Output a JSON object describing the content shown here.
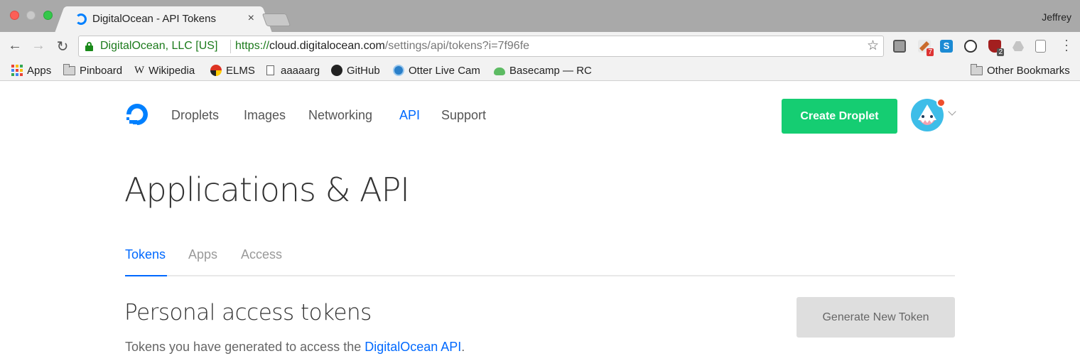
{
  "browser": {
    "tab": {
      "title": "DigitalOcean - API Tokens",
      "close": "×"
    },
    "profile": "Jeffrey",
    "address": {
      "ev_label": "DigitalOcean, LLC [US]",
      "scheme": "https://",
      "host": "cloud.digitalocean.com",
      "path": "/settings/api/tokens?i=7f96fe"
    },
    "extensions": [
      {
        "icon": "extension-plug-icon",
        "badge": ""
      },
      {
        "icon": "extension-ticket-icon",
        "badge": "7"
      },
      {
        "icon": "extension-s-icon",
        "badge": ""
      },
      {
        "icon": "extension-lock-icon",
        "badge": ""
      },
      {
        "icon": "extension-shield-icon",
        "badge": "2"
      },
      {
        "icon": "extension-drive-icon",
        "badge": ""
      },
      {
        "icon": "extension-doc-icon",
        "badge": ""
      }
    ],
    "bookmarks": [
      {
        "label": "Apps",
        "icon": "apps-grid-icon"
      },
      {
        "label": "Pinboard",
        "icon": "folder-icon"
      },
      {
        "label": "Wikipedia",
        "icon": "wikipedia-icon",
        "glyph": "W"
      },
      {
        "label": "ELMS",
        "icon": "elms-icon"
      },
      {
        "label": "aaaaarg",
        "icon": "page-icon"
      },
      {
        "label": "GitHub",
        "icon": "github-icon"
      },
      {
        "label": "Otter Live Cam",
        "icon": "globe-icon"
      },
      {
        "label": "Basecamp — RC",
        "icon": "basecamp-icon"
      }
    ],
    "other_bookmarks": "Other Bookmarks"
  },
  "site": {
    "nav": [
      "Droplets",
      "Images",
      "Networking",
      "API",
      "Support"
    ],
    "active_nav": "API",
    "create_button": "Create Droplet",
    "colors": {
      "accent": "#0069ff",
      "create": "#15cd72",
      "notification": "#ef4e2c"
    }
  },
  "page": {
    "title": "Applications & API",
    "tabs": [
      "Tokens",
      "Apps",
      "Access"
    ],
    "active_tab": "Tokens",
    "section_title": "Personal access tokens",
    "generate_button": "Generate New Token",
    "description_prefix": "Tokens you have generated to access the ",
    "description_link": "DigitalOcean API",
    "description_suffix": "."
  }
}
